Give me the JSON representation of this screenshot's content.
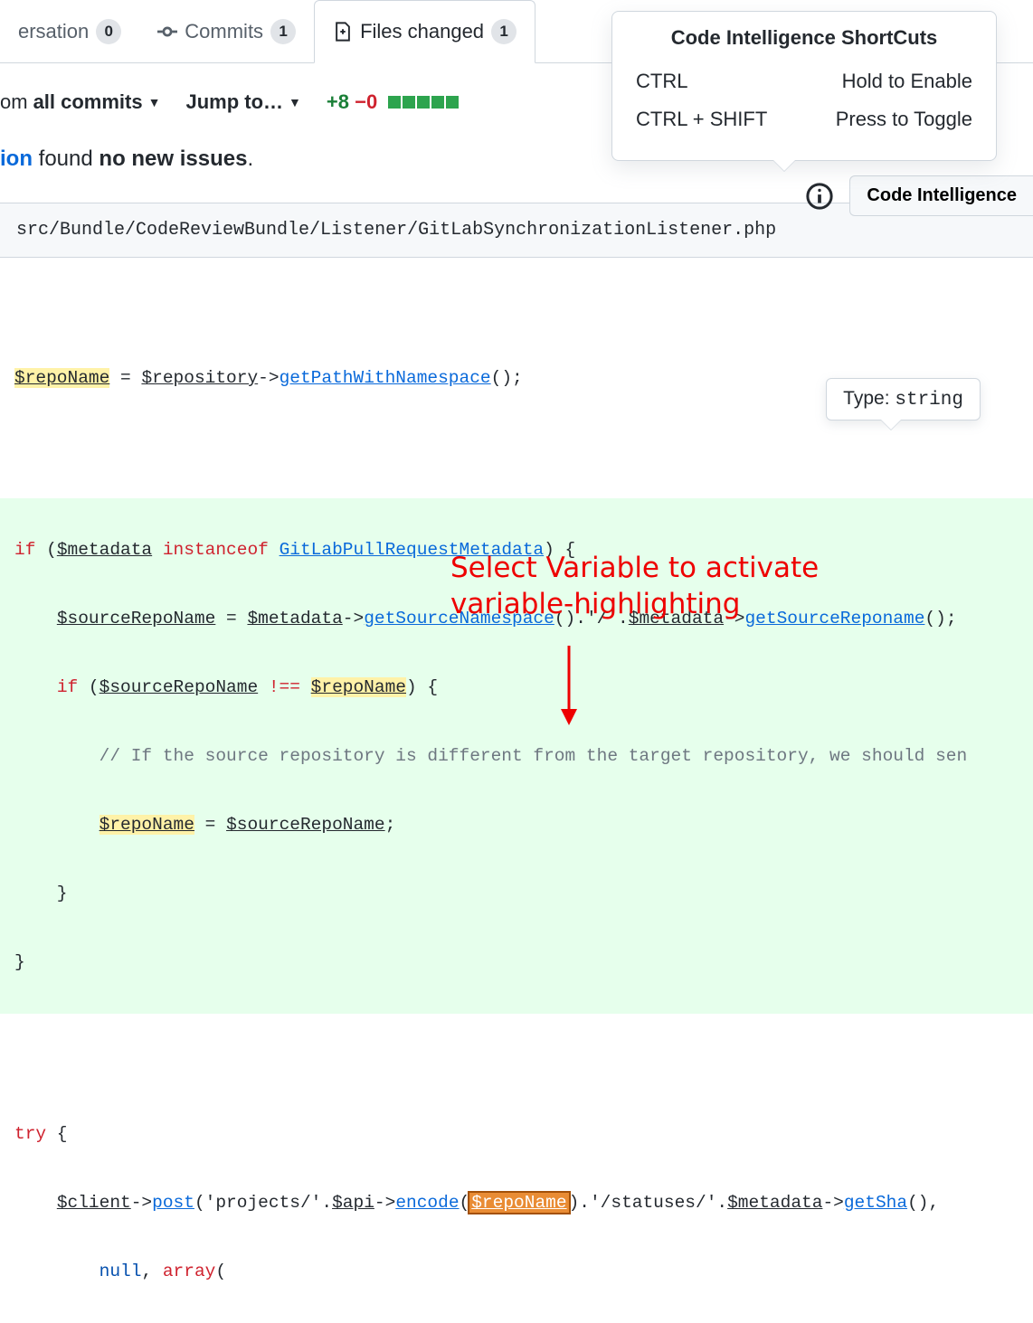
{
  "tabs": {
    "conversation": {
      "label": "ersation",
      "count": "0"
    },
    "commits": {
      "label": "Commits",
      "count": "1"
    },
    "files_changed": {
      "label": "Files changed",
      "count": "1"
    }
  },
  "toolbar": {
    "from_prefix": "om ",
    "from_bold": "all commits",
    "jump_to": "Jump to…",
    "additions": "+8",
    "deletions": "−0"
  },
  "issues": {
    "linkText": "ion",
    "middle": " found ",
    "bold": "no new issues",
    "dot": "."
  },
  "ci_button": "Code Intelligence",
  "shortcuts": {
    "title": "Code Intelligence ShortCuts",
    "rows": [
      {
        "key": "CTRL",
        "desc": "Hold to Enable"
      },
      {
        "key": "CTRL + SHIFT",
        "desc": "Press to Toggle"
      }
    ]
  },
  "tooltip": {
    "label": "Type: ",
    "type": "string"
  },
  "file": {
    "path": "src/Bundle/CodeReviewBundle/Listener/GitLabSynchronizationListener.php"
  },
  "code": {
    "l1": {
      "repoName": "$repoName",
      "eq": " = ",
      "repository": "$repository",
      "arrow": "->",
      "fn": "getPathWithNamespace",
      "rest": "();"
    },
    "l3": {
      "kw_if": "if",
      "po": " (",
      "metadata": "$metadata",
      "sp": " ",
      "kw_inst": "instanceof",
      "sp2": " ",
      "cls": "GitLabPullRequestMetadata",
      "pc": ") {"
    },
    "l4": {
      "indent": "    ",
      "srcRepo": "$sourceRepoName",
      "eq": " = ",
      "metadata": "$metadata",
      "arrow": "->",
      "fn": "getSourceNamespace",
      "mid": "().",
      "str": "'/'",
      "dot": ".",
      "metadata2": "$metadata",
      "arrow2": "->",
      "fn2": "getSourceReponame",
      "rest": "();"
    },
    "l5": {
      "indent": "    ",
      "kw_if": "if",
      "po": " (",
      "srcRepo": "$sourceRepoName",
      "sp": " ",
      "op": "!==",
      "sp2": " ",
      "repoName": "$repoName",
      "pc": ") {"
    },
    "l6": {
      "indent": "        ",
      "comment": "// If the source repository is different from the target repository, we should sen"
    },
    "l7": {
      "indent": "        ",
      "repoName": "$repoName",
      "eq": " = ",
      "srcRepo": "$sourceRepoName",
      "semi": ";"
    },
    "l8": {
      "indent": "    }",
      "text": "    }"
    },
    "l9": {
      "text": "}"
    },
    "l11": {
      "kw": "try",
      "rest": " {"
    },
    "l12": {
      "indent": "    ",
      "client": "$client",
      "arrow": "->",
      "fn": "post",
      "po": "(",
      "str1": "'projects/'",
      "dot": ".",
      "api": "$api",
      "arrow2": "->",
      "fn2": "encode",
      "po2": "(",
      "repoName": "$repoName",
      "pc2": ")",
      "dot2": ".",
      "str2": "'/statuses/'",
      "dot3": ".",
      "metadata": "$metadata",
      "arrow3": "->",
      "fn3": "getSha",
      "rest": "(),"
    },
    "l13": {
      "indent": "        ",
      "null": "null",
      "comma": ", ",
      "kw": "array",
      "rest": "("
    }
  },
  "annotation": {
    "line1": "Select Variable to activate",
    "line2": "variable-highlighting"
  }
}
